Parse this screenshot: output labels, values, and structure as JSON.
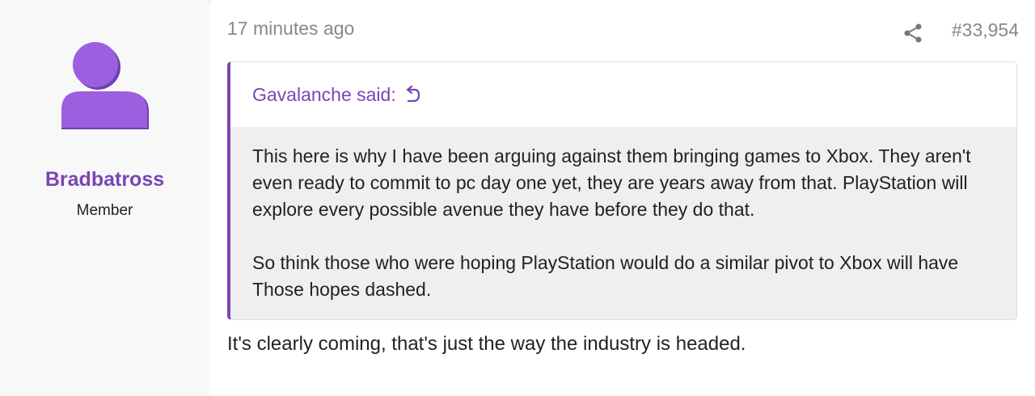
{
  "user": {
    "name": "Bradbatross",
    "title": "Member",
    "avatar_color": "#9b5fe0"
  },
  "post": {
    "timestamp": "17 minutes ago",
    "number": "#33,954",
    "reply_text": "It's clearly coming, that's just the way the industry is headed."
  },
  "quote": {
    "author_label": "Gavalanche said:",
    "paragraph_1": "This here is why I have been arguing against them bringing games to Xbox. They aren't even ready to commit to pc day one yet, they are years away from that. PlayStation will explore every possible avenue they have before they do that.",
    "paragraph_2": "So think those who were hoping PlayStation would do a similar pivot to Xbox will have Those hopes dashed."
  },
  "icons": {
    "share": "share-icon",
    "jump_to_quote": "jump-to-quote-icon",
    "avatar": "default-avatar-icon"
  },
  "colors": {
    "accent": "#7b45b5",
    "muted_text": "#888888",
    "quote_background": "#efefef"
  }
}
